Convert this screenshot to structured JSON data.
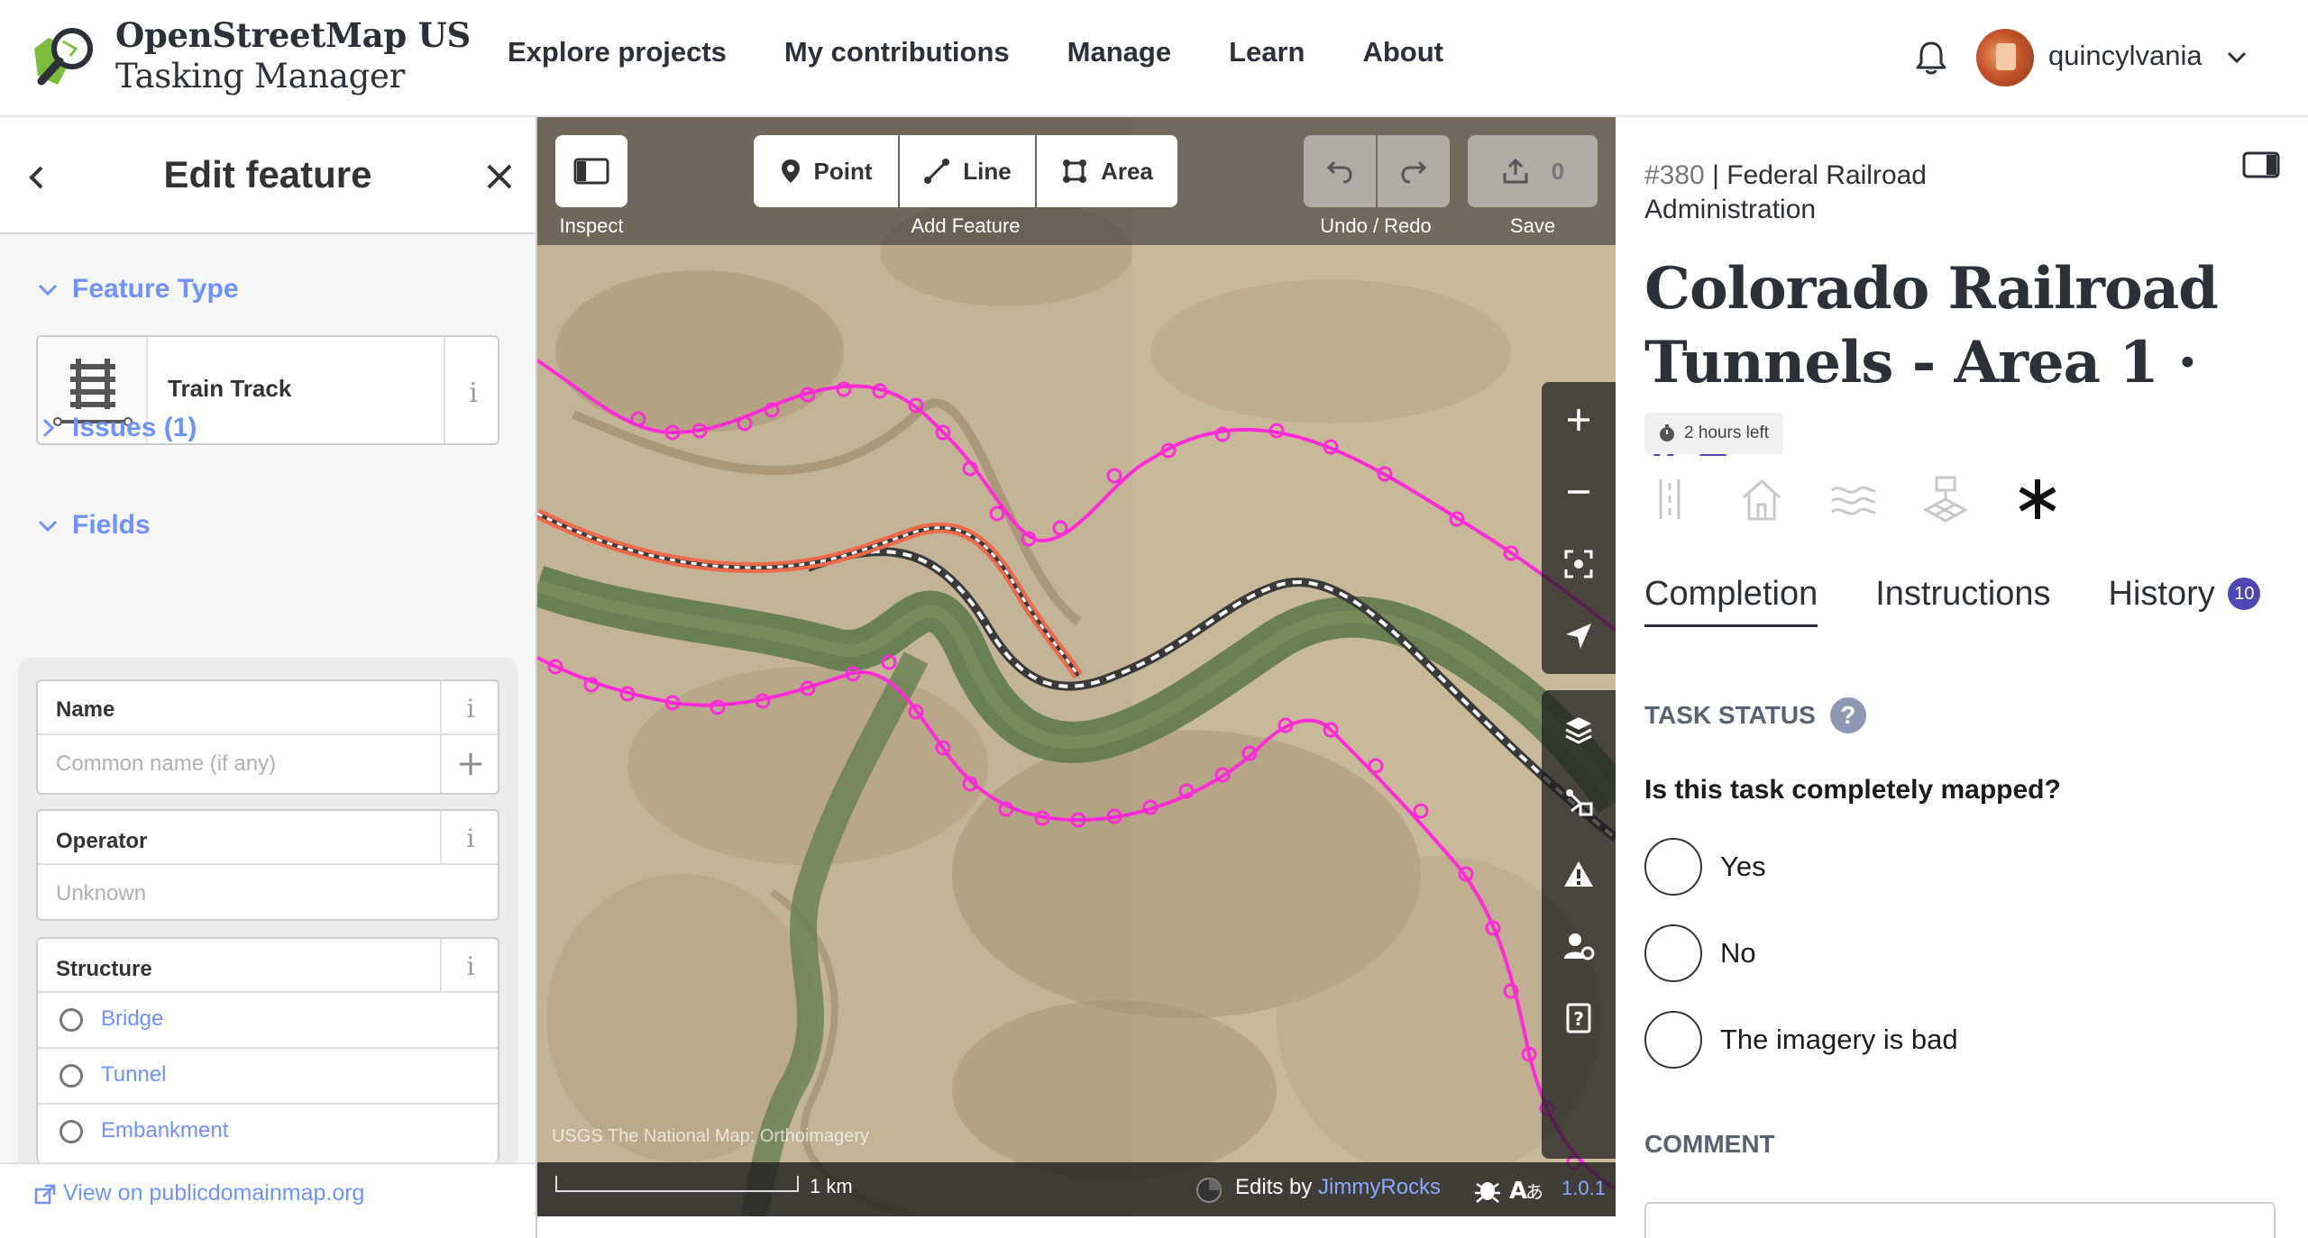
{
  "header": {
    "brand_line1": "OpenStreetMap US",
    "brand_line2": "Tasking Manager",
    "nav": [
      "Explore projects",
      "My contributions",
      "Manage",
      "Learn",
      "About"
    ],
    "username": "quincylvania",
    "icons": {
      "logo": "osm-magnifier-logo",
      "bell": "bell-icon",
      "chevron": "chevron-down-icon"
    }
  },
  "sidebar": {
    "title": "Edit feature",
    "feature_type_section": "Feature Type",
    "feature_type": "Train Track",
    "issues_section": "Issues (1)",
    "fields_section": "Fields",
    "fields": {
      "name_label": "Name",
      "name_placeholder": "Common name (if any)",
      "operator_label": "Operator",
      "operator_placeholder": "Unknown",
      "structure_label": "Structure",
      "structure_options": [
        "Bridge",
        "Tunnel",
        "Embankment"
      ]
    },
    "footer_link": "View on publicdomainmap.org"
  },
  "map": {
    "toolbar": {
      "inspect_caption": "Inspect",
      "point": "Point",
      "line": "Line",
      "area": "Area",
      "add_feature_caption": "Add Feature",
      "undo_redo_caption": "Undo / Redo",
      "save_count": "0",
      "save_caption": "Save"
    },
    "attribution": "USGS The National Map: Orthoimagery",
    "scale": "1 km",
    "edits_prefix": "Edits by",
    "edits_user": "JimmyRocks",
    "version": "1.0.1",
    "colors": {
      "magenta": "#ff2bd6",
      "orange": "#ef6a4b",
      "river": "#5f7a4c"
    }
  },
  "task": {
    "project_number": "#380",
    "project_org": "Federal Railroad Administration",
    "title": "Colorado Railroad Tunnels - Area 1 ·",
    "task_id": "#1",
    "time_left": "2 hours left",
    "tabs": [
      "Completion",
      "Instructions",
      "History"
    ],
    "history_count": "10",
    "status_heading": "TASK STATUS",
    "question": "Is this task completely mapped?",
    "options": [
      "Yes",
      "No",
      "The imagery is bad"
    ],
    "comment_heading": "COMMENT",
    "accent": "#5046b4"
  }
}
